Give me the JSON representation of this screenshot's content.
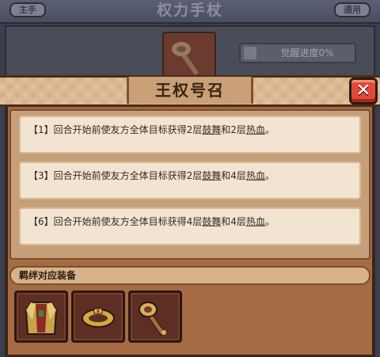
{
  "background": {
    "title": "权力手杖",
    "tab_left": "主手",
    "tab_right": "通用",
    "progress_label": "觉醒进度0%"
  },
  "modal": {
    "title": "王权号召",
    "close_icon": "close-icon",
    "effects": [
      {
        "index": "【1】",
        "prefix": "回合开始前使友方全体目标获得2层",
        "kw1": "鼓舞",
        "mid": "和2层",
        "kw2": "热血",
        "end": "。"
      },
      {
        "index": "【3】",
        "prefix": "回合开始前使友方全体目标获得2层",
        "kw1": "鼓舞",
        "mid": "和4层",
        "kw2": "热血",
        "end": "。"
      },
      {
        "index": "【6】",
        "prefix": "回合开始前使友方全体目标获得4层",
        "kw1": "鼓舞",
        "mid": "和4层",
        "kw2": "热血",
        "end": "。"
      }
    ],
    "bond_title": "羁绊对应装备",
    "equipment": [
      {
        "icon": "armor-cape-icon"
      },
      {
        "icon": "crown-ring-icon"
      },
      {
        "icon": "scepter-icon"
      }
    ]
  },
  "colors": {
    "modal_body": "#a46b45",
    "header_band": "#d7b187",
    "close_button": "#e04a3a",
    "effect_card": "#f1e4d1"
  }
}
